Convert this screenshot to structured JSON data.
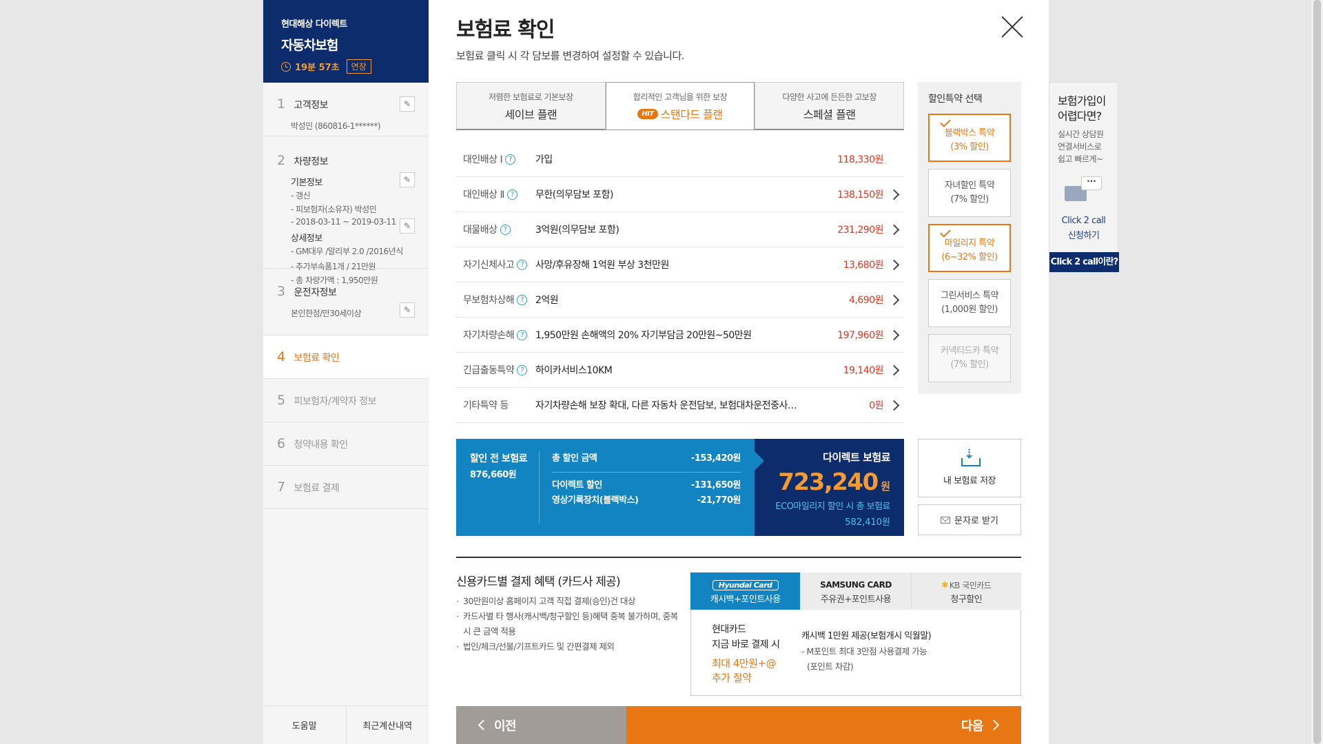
{
  "brand": {
    "company": "현대해상 다이렉트",
    "product": "자동차보험",
    "timer": "19분 57초",
    "extend_label": "연장"
  },
  "steps": [
    {
      "num": "1",
      "title": "고객정보",
      "detail": "박성민 (860816-1******)"
    },
    {
      "num": "2",
      "title": "차량정보",
      "basic_label": "기본정보",
      "basic_lines": [
        "- 갱신",
        "- 피보험자(소유자) 박성민",
        "- 2018-03-11 ~ 2019-03-11"
      ],
      "detail_label": "상세정보",
      "detail_lines": [
        "- GM대우 /말리부 2.0 /2016년식",
        "- 추가부속품1개 / 21만원",
        "- 총 차량가액 : 1,950만원"
      ]
    },
    {
      "num": "3",
      "title": "운전자정보",
      "detail": "본인한정/만30세이상"
    },
    {
      "num": "4",
      "title": "보험료 확인"
    },
    {
      "num": "5",
      "title": "피보험자/계약자 정보"
    },
    {
      "num": "6",
      "title": "청약내용 확인"
    },
    {
      "num": "7",
      "title": "보험료 결제"
    }
  ],
  "sidebar_footer": {
    "help": "도움말",
    "recent": "최근계산내역"
  },
  "page": {
    "title": "보험료 확인",
    "desc": "보험료 클릭 시 각 담보를 변경하여 설정할 수 있습니다."
  },
  "plans": [
    {
      "desc": "저렴한 보험료로 기본보장",
      "name": "세이브 플랜"
    },
    {
      "desc": "합리적인 고객님을 위한 보장",
      "badge": "HIT",
      "name": "스탠다드 플랜"
    },
    {
      "desc": "다양한 사고에 든든한 고보장",
      "name": "스페셜 플랜"
    }
  ],
  "coverages": [
    {
      "name": "대인배상 Ⅰ",
      "value": "가입",
      "price": "118,330원"
    },
    {
      "name": "대인배상 Ⅱ",
      "value": "무한(의무담보 포함)",
      "price": "138,150원"
    },
    {
      "name": "대물배상",
      "value": "3억원(의무담보 포함)",
      "price": "231,290원"
    },
    {
      "name": "자기신체사고",
      "value": "사망/후유장해 1억원 부상 3천만원",
      "price": "13,680원"
    },
    {
      "name": "무보험차상해",
      "value": "2억원",
      "price": "4,690원"
    },
    {
      "name": "자기차량손해",
      "value": "1,950만원 손해액의 20% 자기부담금 20만원~50만원",
      "price": "197,960원"
    },
    {
      "name": "긴급출동특약",
      "value": "하이카서비스10KM",
      "price": "19,140원"
    },
    {
      "name": "기타특약 등",
      "value": "자기차량손해 보장 확대, 다른 자동차 운전담보, 보험대차운전중사…",
      "price": "0원"
    }
  ],
  "summary": {
    "before_label": "할인 전 보험료",
    "before_value": "876,660원",
    "total_discount_label": "총 할인 금액",
    "total_discount_value": "-153,420원",
    "direct_label": "다이렉트 할인",
    "direct_value": "-131,650원",
    "blackbox_label": "영상기록장치(블랙박스)",
    "blackbox_value": "-21,770원",
    "final_label": "다이렉트 보험료",
    "final_value": "723,240",
    "final_unit": "원",
    "eco_label": "ECO마일리지 할인 시 총 보험료",
    "eco_value": "582,410원"
  },
  "discounts": {
    "title": "할인특약 선택",
    "items": [
      {
        "name": "블랙박스 특약",
        "rate": "(3% 할인)",
        "state": "on"
      },
      {
        "name": "자녀할인 특약",
        "rate": "(7% 할인)",
        "state": "off"
      },
      {
        "name": "마일리지 특약",
        "rate": "(6~32% 할인)",
        "state": "on"
      },
      {
        "name": "그린서비스 특약",
        "rate": "(1,000원 할인)",
        "state": "off"
      },
      {
        "name": "커넥티드카 특약",
        "rate": "(7% 할인)",
        "state": "dim"
      }
    ]
  },
  "actions": {
    "save": "내 보험료 저장",
    "sms": "문자로 받기"
  },
  "card": {
    "title": "신용카드별 결제 혜택 (카드사 제공)",
    "notes": [
      "30만원이상 홈페이지 고객 직접 결제(승인)건 대상",
      "카드사별 타 행사(캐시백/청구할인 등)혜택 중복 불가하며, 중복 시 큰 금액 적용",
      "법인/체크/선불/기프트카드 및 간편결제 제외"
    ],
    "tabs": [
      {
        "logo": "Hyundai Card",
        "label": "캐시백+포인트사용"
      },
      {
        "logo": "SAMSUNG CARD",
        "label": "주유권+포인트사용"
      },
      {
        "logo": "KB 국민카드",
        "label": "청구할인"
      }
    ],
    "body_left_1": "현대카드",
    "body_left_2": "지금 바로 결제 시",
    "body_left_hl1": "최대 4만원+@",
    "body_left_hl2": "추가 절약",
    "body_right_1": "캐시백 1만원 제공(보험개시 익월말)",
    "body_right_2": "- M포인트 최대 3만점 사용결제 가능",
    "body_right_3": "(포인트 차감)"
  },
  "nav": {
    "prev": "이전",
    "next": "다음"
  },
  "call_widget": {
    "title_1": "보험가입이",
    "title_2": "어렵다면?",
    "sub_1": "실시간 상담원",
    "sub_2": "연결서비스로",
    "sub_3": "쉽고 빠르게~",
    "bubble": "···",
    "call_1": "Click 2 call",
    "call_2": "신청하기",
    "button": "Click 2 call이란?"
  },
  "colors": {
    "navy": "#0d2c6b",
    "blue": "#1184c1",
    "orange": "#e87612",
    "red_price": "#e0341f"
  }
}
